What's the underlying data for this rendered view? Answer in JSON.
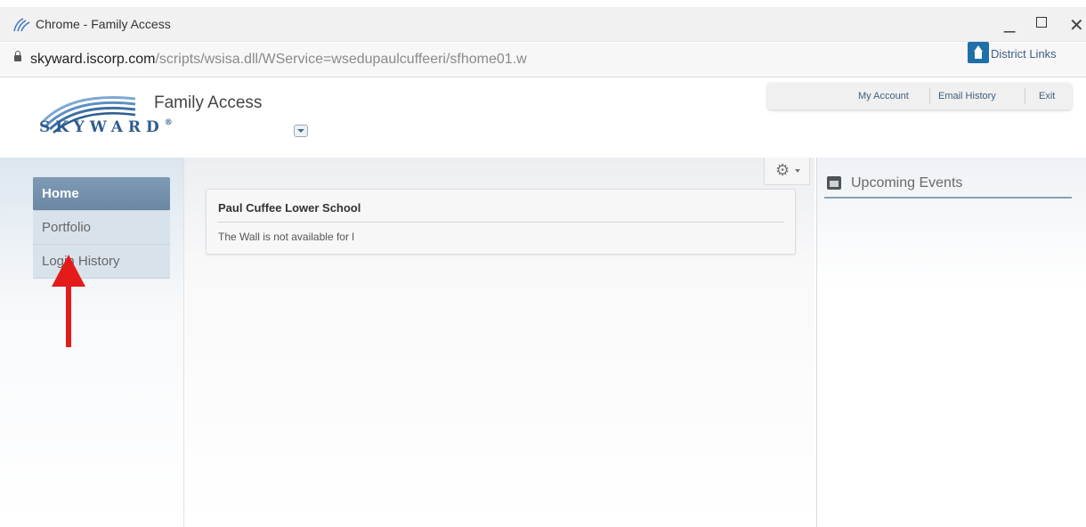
{
  "window": {
    "title": "Chrome - Family Access",
    "minimize_glyph": "_",
    "close_glyph": "✕"
  },
  "address_bar": {
    "host": "skyward.iscorp.com",
    "path": "/scripts/wsisa.dll/WService=wsedupaulcuffeeri/sfhome01.w"
  },
  "header": {
    "logo_text": "SKYWARD",
    "logo_mark": "®",
    "app_name": "Family Access",
    "account_links": [
      "My Account",
      "Email History",
      "Exit"
    ],
    "district_links_label": "District Links"
  },
  "sidebar": {
    "items": [
      {
        "label": "Home",
        "active": true
      },
      {
        "label": "Portfolio",
        "active": false
      },
      {
        "label": "Login History",
        "active": false
      }
    ]
  },
  "wall": {
    "school_name": "Paul Cuffee Lower School",
    "message": "The Wall is not available for l"
  },
  "events": {
    "title": "Upcoming Events"
  },
  "colors": {
    "accent": "#3e5f82",
    "nav_active": "#6f8cab",
    "annotation_arrow": "#e41b1b"
  }
}
